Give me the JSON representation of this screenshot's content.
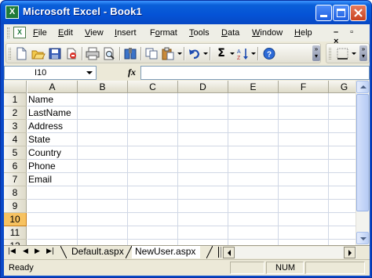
{
  "window": {
    "title": "Microsoft Excel - Book1",
    "app_icon": "X",
    "colors": {
      "titlebar": "#0553d6",
      "close": "#c8411f",
      "chrome": "#ece9d8",
      "active_row": "#f7c260"
    }
  },
  "menu": {
    "items": [
      {
        "label": "File",
        "mnemonic": "F"
      },
      {
        "label": "Edit",
        "mnemonic": "E"
      },
      {
        "label": "View",
        "mnemonic": "V"
      },
      {
        "label": "Insert",
        "mnemonic": "I"
      },
      {
        "label": "Format",
        "mnemonic": "o"
      },
      {
        "label": "Tools",
        "mnemonic": "T"
      },
      {
        "label": "Data",
        "mnemonic": "D"
      },
      {
        "label": "Window",
        "mnemonic": "W"
      },
      {
        "label": "Help",
        "mnemonic": "H"
      }
    ],
    "mdi_controls": "– ▫ ×"
  },
  "toolbar": {
    "icons": [
      "new-icon",
      "open-icon",
      "save-icon",
      "permission-icon",
      "print-icon",
      "print-preview-icon",
      "research-icon",
      "copy-icon",
      "paste-icon",
      "undo-icon",
      "autosum-icon",
      "sort-ascending-icon",
      "help-icon",
      "borders-icon"
    ],
    "autosum_label": "Σ"
  },
  "formula_bar": {
    "name_box": "I10",
    "fx_label": "fx",
    "formula": ""
  },
  "grid": {
    "columns": [
      "A",
      "B",
      "C",
      "D",
      "E",
      "F",
      "G"
    ],
    "rows": [
      "1",
      "2",
      "3",
      "4",
      "5",
      "6",
      "7",
      "8",
      "9",
      "10",
      "11",
      "12"
    ],
    "active_row": "10",
    "cells_a": [
      "Name",
      "LastName",
      "Address",
      "State",
      "Country",
      "Phone",
      "Email"
    ]
  },
  "sheets": {
    "tabs": [
      "Default.aspx",
      "NewUser.aspx"
    ],
    "active": "NewUser.aspx"
  },
  "status": {
    "text": "Ready",
    "num": "NUM"
  }
}
